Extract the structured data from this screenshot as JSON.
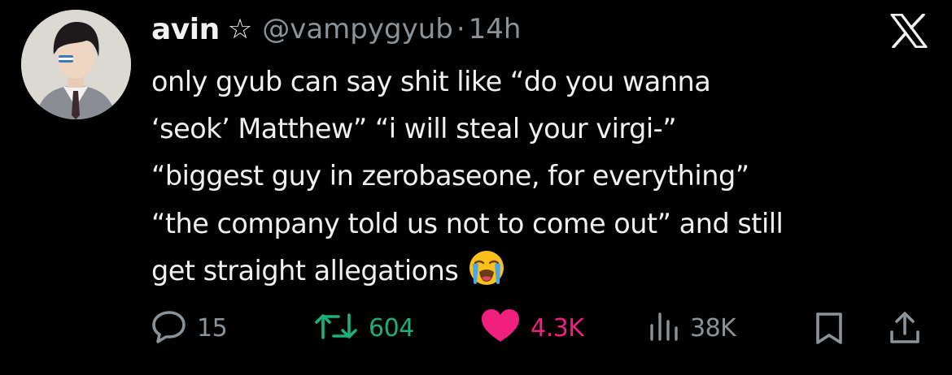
{
  "author": {
    "name": "avin",
    "badge_icon": "star-outline-icon",
    "handle": "@vampygyub",
    "separator": "·",
    "time": "14h"
  },
  "platform_logo": "x-logo-icon",
  "tweet": {
    "lines": [
      "only gyub can say shit like “do you wanna",
      "‘seok’ Matthew” “i will steal your virgi-”",
      "“biggest guy in zerobaseone, for everything”",
      "“the company told us not to come out” and still",
      "get straight allegations"
    ],
    "trailing_emoji": "loudly-crying-face-emoji"
  },
  "actions": {
    "replies": "15",
    "reposts": "604",
    "likes": "4.3K",
    "views": "38K"
  },
  "colors": {
    "background": "#000000",
    "text": "#e7e9ea",
    "muted": "#8b9298",
    "repost": "#1dae7e",
    "like": "#f1207f"
  }
}
